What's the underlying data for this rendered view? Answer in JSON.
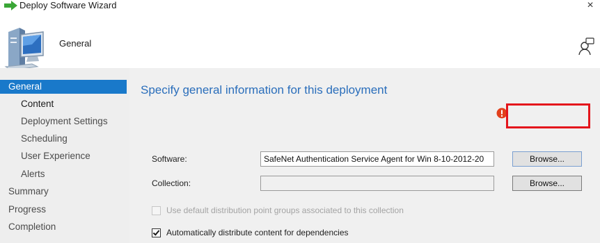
{
  "window": {
    "title": "Deploy Software Wizard",
    "close_glyph": "×"
  },
  "header": {
    "title": "General"
  },
  "sidebar": {
    "items": [
      {
        "label": "General",
        "level": "top",
        "state": "selected"
      },
      {
        "label": "Content",
        "level": "sub",
        "state": "current"
      },
      {
        "label": "Deployment Settings",
        "level": "sub",
        "state": "normal"
      },
      {
        "label": "Scheduling",
        "level": "sub",
        "state": "normal"
      },
      {
        "label": "User Experience",
        "level": "sub",
        "state": "normal"
      },
      {
        "label": "Alerts",
        "level": "sub",
        "state": "normal"
      },
      {
        "label": "Summary",
        "level": "top",
        "state": "normal"
      },
      {
        "label": "Progress",
        "level": "top",
        "state": "normal"
      },
      {
        "label": "Completion",
        "level": "top",
        "state": "normal"
      }
    ]
  },
  "main": {
    "title": "Specify general information for this deployment",
    "software": {
      "label": "Software:",
      "value": "SafeNet Authentication Service Agent for Win 8-10-2012-20",
      "browse_label": "Browse..."
    },
    "collection": {
      "label": "Collection:",
      "value": "",
      "browse_label": "Browse..."
    },
    "checkboxes": {
      "use_default_dp": {
        "label": "Use default distribution point groups associated to this collection",
        "checked": false,
        "enabled": false
      },
      "auto_distribute": {
        "label": "Automatically distribute content for dependencies",
        "checked": true,
        "enabled": true
      }
    }
  },
  "colors": {
    "accent": "#1979ca",
    "title_blue": "#2a6ebb",
    "highlight_red": "#e4151c",
    "sidebar_bg": "#eeeeee",
    "main_bg": "#f0f0f0"
  },
  "icons": {
    "title_icon": "green-arrow-icon",
    "header_icon": "computer-icon",
    "help_icon": "help-person-icon",
    "error_icon": "error-icon"
  }
}
